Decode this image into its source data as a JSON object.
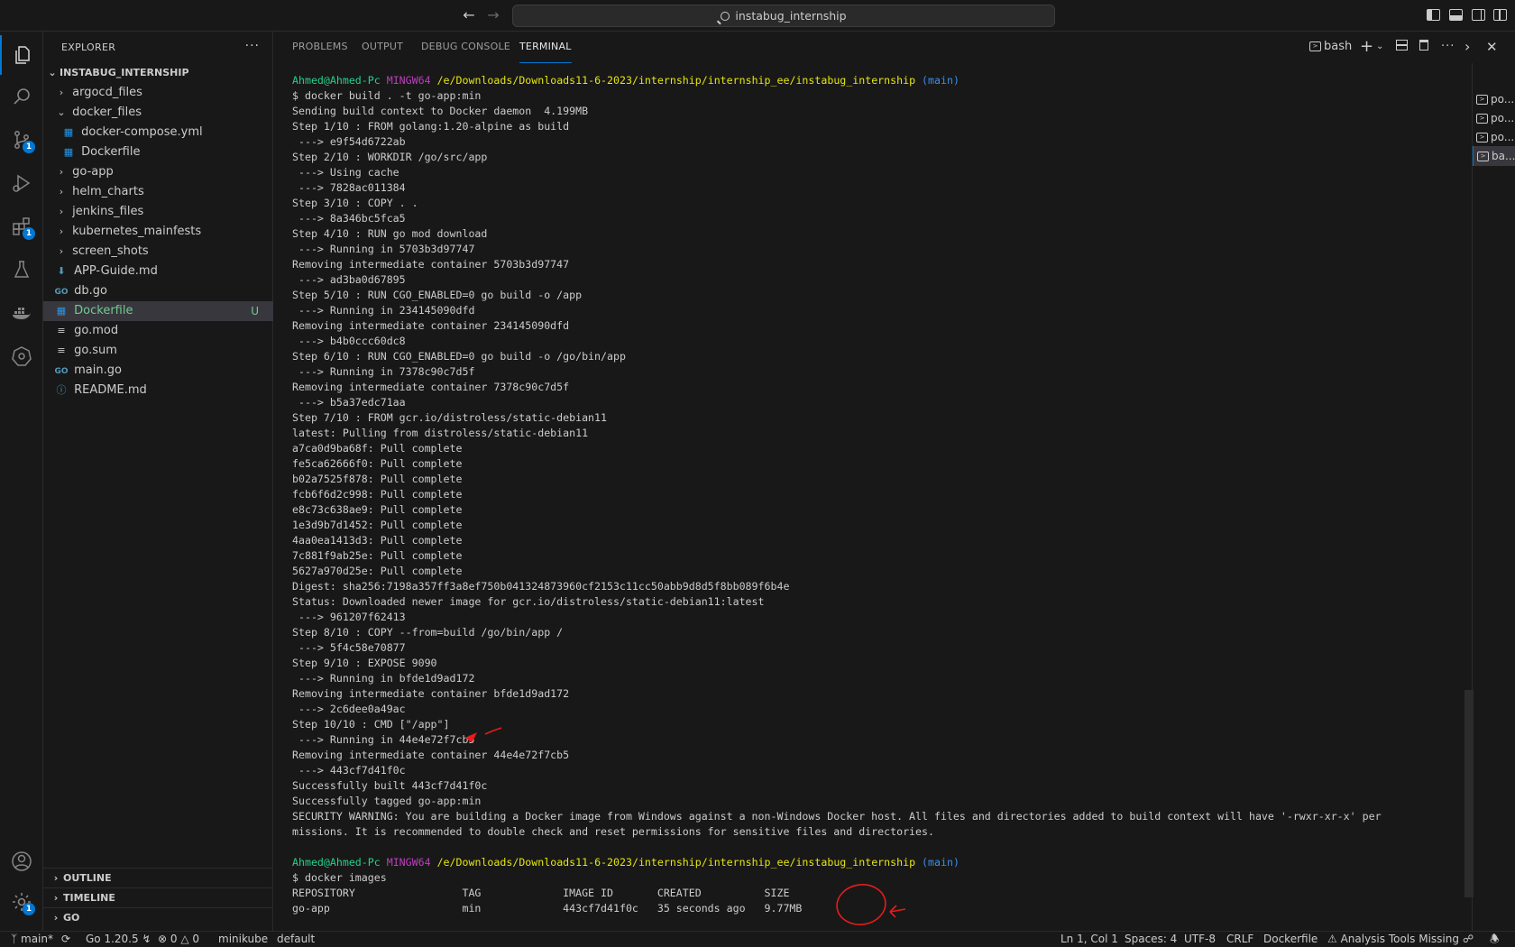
{
  "titlebar": {
    "search_text": "instabug_internship",
    "back_icon": "arrow-left-icon",
    "forward_icon": "arrow-right-icon"
  },
  "activity": {
    "scm_badge": "1",
    "extensions_badge": "1",
    "settings_badge": "1"
  },
  "sidebar": {
    "title": "EXPLORER",
    "more": "···",
    "root": "INSTABUG_INTERNSHIP",
    "items": [
      {
        "label": "argocd_files",
        "type": "folder",
        "expanded": false
      },
      {
        "label": "docker_files",
        "type": "folder",
        "expanded": true
      },
      {
        "label": "docker-compose.yml",
        "type": "docker",
        "indent": 1
      },
      {
        "label": "Dockerfile",
        "type": "docker",
        "indent": 1
      },
      {
        "label": "go-app",
        "type": "folder",
        "expanded": false
      },
      {
        "label": "helm_charts",
        "type": "folder",
        "expanded": false
      },
      {
        "label": "jenkins_files",
        "type": "folder",
        "expanded": false
      },
      {
        "label": "kubernetes_mainfests",
        "type": "folder",
        "expanded": false
      },
      {
        "label": "screen_shots",
        "type": "folder",
        "expanded": false
      },
      {
        "label": "APP-Guide.md",
        "type": "md-down"
      },
      {
        "label": "db.go",
        "type": "go"
      },
      {
        "label": "Dockerfile",
        "type": "docker",
        "selected": true,
        "badge": "U"
      },
      {
        "label": "go.mod",
        "type": "lines"
      },
      {
        "label": "go.sum",
        "type": "lines"
      },
      {
        "label": "main.go",
        "type": "go"
      },
      {
        "label": "README.md",
        "type": "info"
      }
    ],
    "sections": [
      "OUTLINE",
      "TIMELINE",
      "GO"
    ]
  },
  "panel": {
    "tabs": [
      "PROBLEMS",
      "OUTPUT",
      "DEBUG CONSOLE",
      "TERMINAL"
    ],
    "active_tab": "TERMINAL",
    "shell_label": "bash"
  },
  "terminal": {
    "prompt": {
      "user": "Ahmed@Ahmed-Pc",
      "mingw": "MINGW64",
      "path": "/e/Downloads/Downloads11-6-2023/internship/internship_ee/instabug_internship",
      "branch": "(main)"
    },
    "lines1": [
      "$ docker build . -t go-app:min",
      "Sending build context to Docker daemon  4.199MB",
      "Step 1/10 : FROM golang:1.20-alpine as build",
      " ---> e9f54d6722ab",
      "Step 2/10 : WORKDIR /go/src/app",
      " ---> Using cache",
      " ---> 7828ac011384",
      "Step 3/10 : COPY . .",
      " ---> 8a346bc5fca5",
      "Step 4/10 : RUN go mod download",
      " ---> Running in 5703b3d97747",
      "Removing intermediate container 5703b3d97747",
      " ---> ad3ba0d67895",
      "Step 5/10 : RUN CGO_ENABLED=0 go build -o /app",
      " ---> Running in 234145090dfd",
      "Removing intermediate container 234145090dfd",
      " ---> b4b0ccc60dc8",
      "Step 6/10 : RUN CGO_ENABLED=0 go build -o /go/bin/app",
      " ---> Running in 7378c90c7d5f",
      "Removing intermediate container 7378c90c7d5f",
      " ---> b5a37edc71aa",
      "Step 7/10 : FROM gcr.io/distroless/static-debian11",
      "latest: Pulling from distroless/static-debian11",
      "a7ca0d9ba68f: Pull complete",
      "fe5ca62666f0: Pull complete",
      "b02a7525f878: Pull complete",
      "fcb6f6d2c998: Pull complete",
      "e8c73c638ae9: Pull complete",
      "1e3d9b7d1452: Pull complete",
      "4aa0ea1413d3: Pull complete",
      "7c881f9ab25e: Pull complete",
      "5627a970d25e: Pull complete",
      "Digest: sha256:7198a357ff3a8ef750b041324873960cf2153c11cc50abb9d8d5f8bb089f6b4e",
      "Status: Downloaded newer image for gcr.io/distroless/static-debian11:latest",
      " ---> 961207f62413",
      "Step 8/10 : COPY --from=build /go/bin/app /",
      " ---> 5f4c58e70877",
      "Step 9/10 : EXPOSE 9090",
      " ---> Running in bfde1d9ad172",
      "Removing intermediate container bfde1d9ad172",
      " ---> 2c6dee0a49ac",
      "Step 10/10 : CMD [\"/app\"]",
      " ---> Running in 44e4e72f7cb5",
      "Removing intermediate container 44e4e72f7cb5",
      " ---> 443cf7d41f0c",
      "Successfully built 443cf7d41f0c",
      "Successfully tagged go-app:min",
      "SECURITY WARNING: You are building a Docker image from Windows against a non-Windows Docker host. All files and directories added to build context will have '-rwxr-xr-x' per",
      "missions. It is recommended to double check and reset permissions for sensitive files and directories.",
      ""
    ],
    "lines2": [
      "$ docker images",
      "REPOSITORY                 TAG             IMAGE ID       CREATED          SIZE",
      "go-app                     min             443cf7d41f0c   35 seconds ago   9.77MB"
    ]
  },
  "terminal_list": [
    {
      "label": "po..."
    },
    {
      "label": "po..."
    },
    {
      "label": "po..."
    },
    {
      "label": "ba...",
      "active": true
    }
  ],
  "statusbar": {
    "branch": "main*",
    "go_version": "Go 1.20.5",
    "errors": "0",
    "warnings": "0",
    "cluster": "minikube",
    "namespace": "default",
    "position": "Ln 1, Col 1",
    "spaces": "Spaces: 4",
    "encoding": "UTF-8",
    "eol": "CRLF",
    "language": "Dockerfile",
    "analysis": "Analysis Tools Missing"
  },
  "colors": {
    "accent": "#0078d4",
    "annotation": "#e51c1c",
    "git_untracked": "#73c991"
  }
}
